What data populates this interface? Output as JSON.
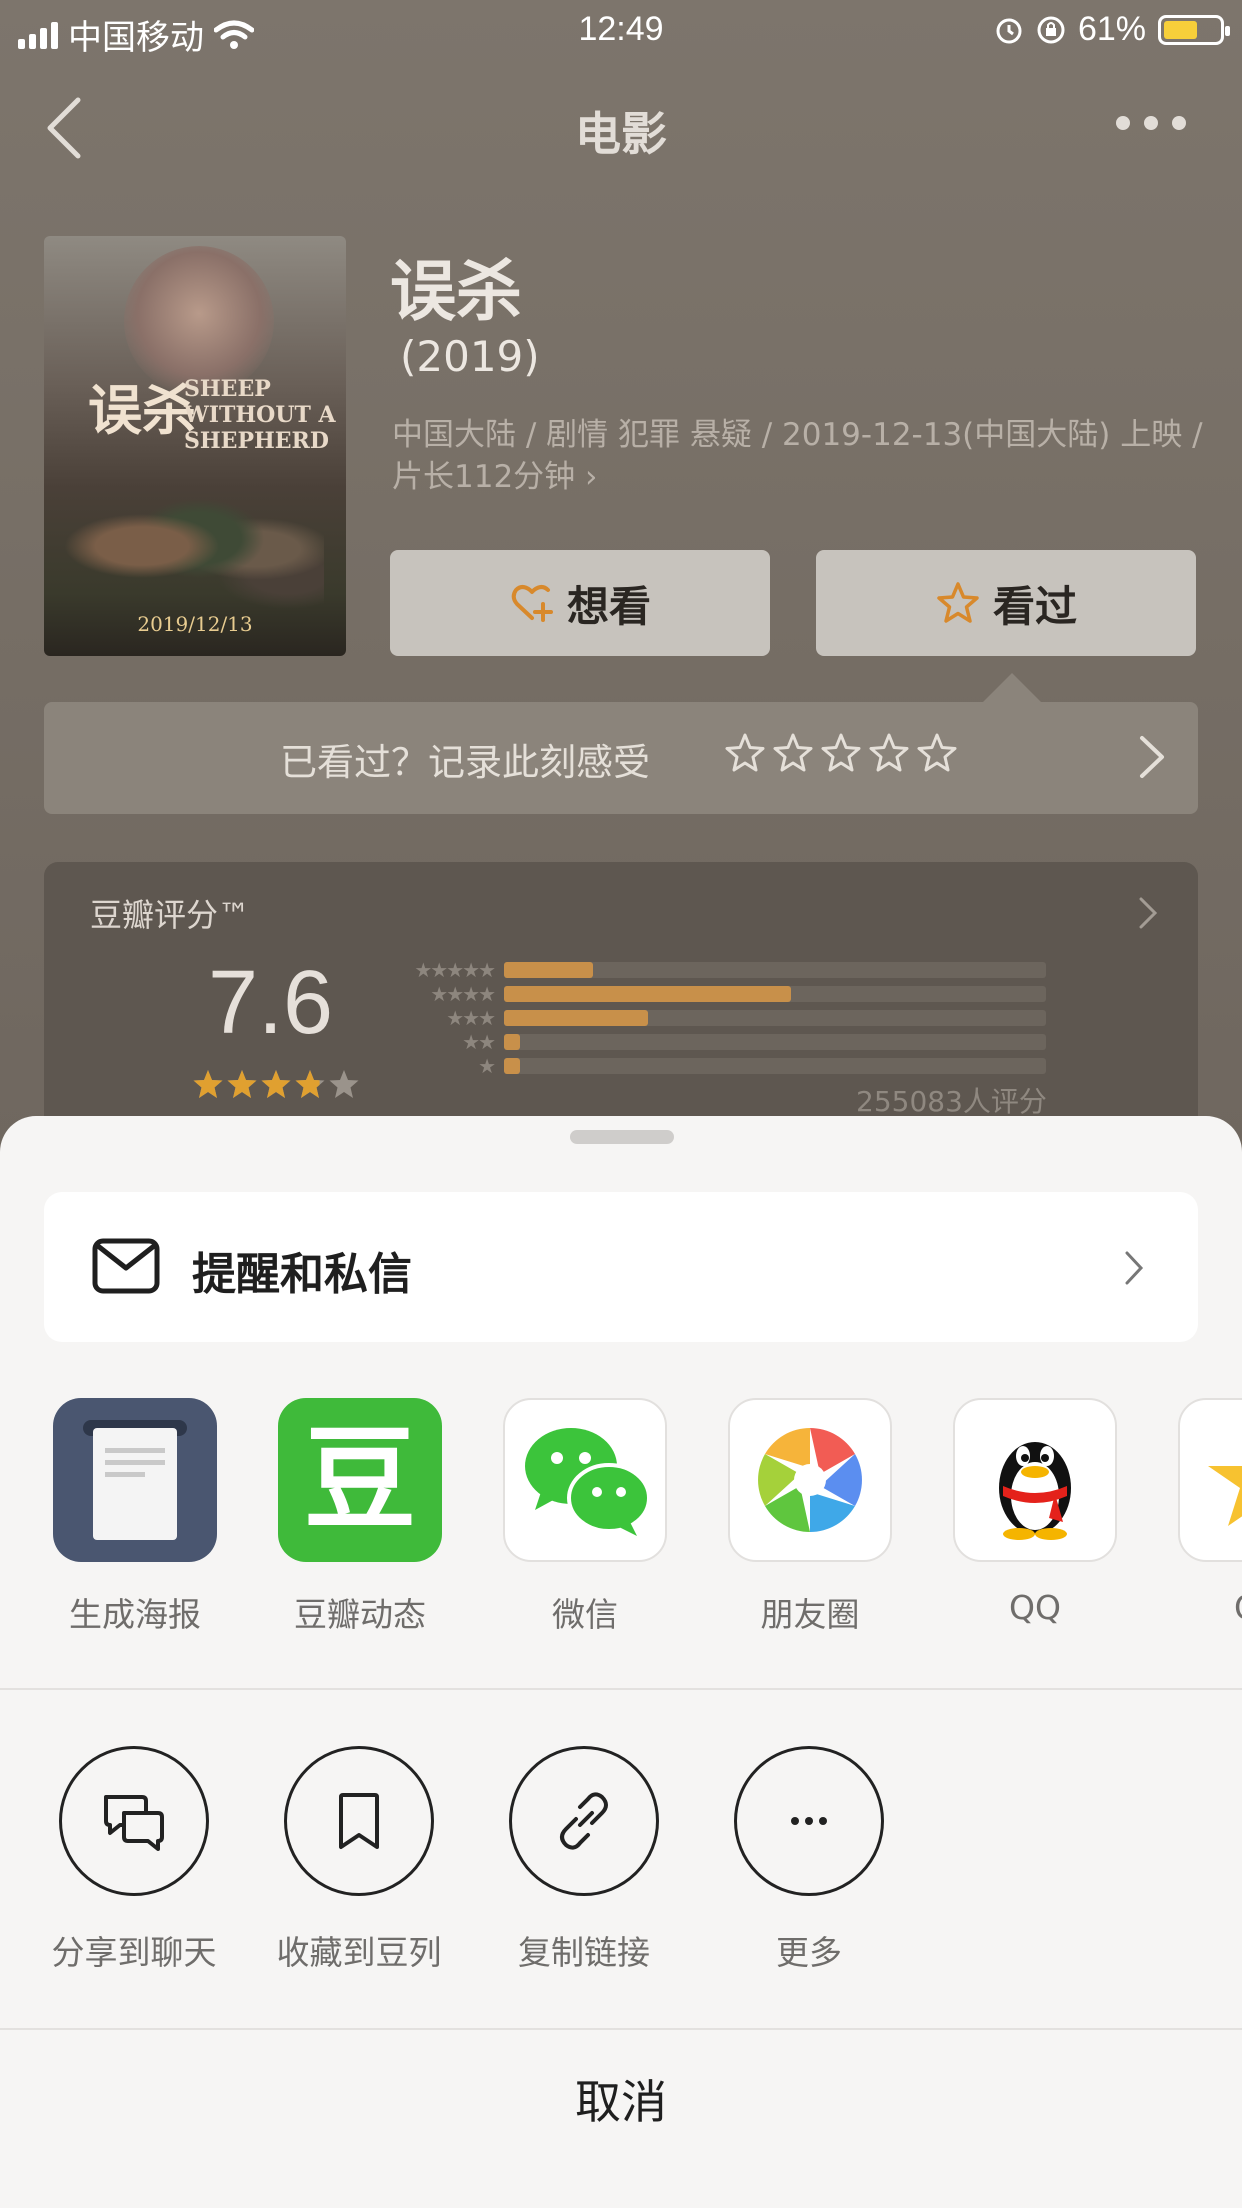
{
  "status_bar": {
    "carrier": "中国移动",
    "time": "12:49",
    "battery": "61%"
  },
  "nav": {
    "title": "电影"
  },
  "movie": {
    "title": "误杀",
    "year": "(2019)",
    "meta": "中国大陆 / 剧情 犯罪 悬疑 / 2019-12-13(中国大陆) 上映 / 片长112分钟 ›",
    "poster_cn": "误杀",
    "poster_en": "SHEEP WITHOUT A SHEPHERD",
    "poster_date": "2019/12/13"
  },
  "actions": {
    "want_label": "想看",
    "watched_label": "看过"
  },
  "feel": {
    "text": "已看过？记录此刻感受"
  },
  "rating": {
    "label": "豆瓣评分™",
    "score": "7.6",
    "stars_value": 3.8,
    "distribution": [
      {
        "stars": "★★★★★",
        "fraction": 0.165
      },
      {
        "stars": "★★★★",
        "fraction": 0.53
      },
      {
        "stars": "★★★",
        "fraction": 0.265
      },
      {
        "stars": "★★",
        "fraction": 0.03
      },
      {
        "stars": "★",
        "fraction": 0.03
      }
    ],
    "count": "255083人评分"
  },
  "sheet": {
    "remind_label": "提醒和私信",
    "apps": [
      {
        "label": "生成海报",
        "icon": "poster-icon"
      },
      {
        "label": "豆瓣动态",
        "icon": "douban-icon"
      },
      {
        "label": "微信",
        "icon": "wechat-icon"
      },
      {
        "label": "朋友圈",
        "icon": "moments-icon"
      },
      {
        "label": "QQ",
        "icon": "qq-icon"
      },
      {
        "label": "QQ",
        "icon": "qzone-icon"
      }
    ],
    "actions": [
      {
        "label": "分享到聊天",
        "icon": "chat-icon"
      },
      {
        "label": "收藏到豆列",
        "icon": "bookmark-icon"
      },
      {
        "label": "复制链接",
        "icon": "link-icon"
      },
      {
        "label": "更多",
        "icon": "more-icon"
      }
    ],
    "cancel_label": "取消",
    "douban_glyph": "豆"
  },
  "colors": {
    "accent_orange": "#c8904a",
    "douban_green": "#3fba3a",
    "star_gold": "#e0a030"
  }
}
